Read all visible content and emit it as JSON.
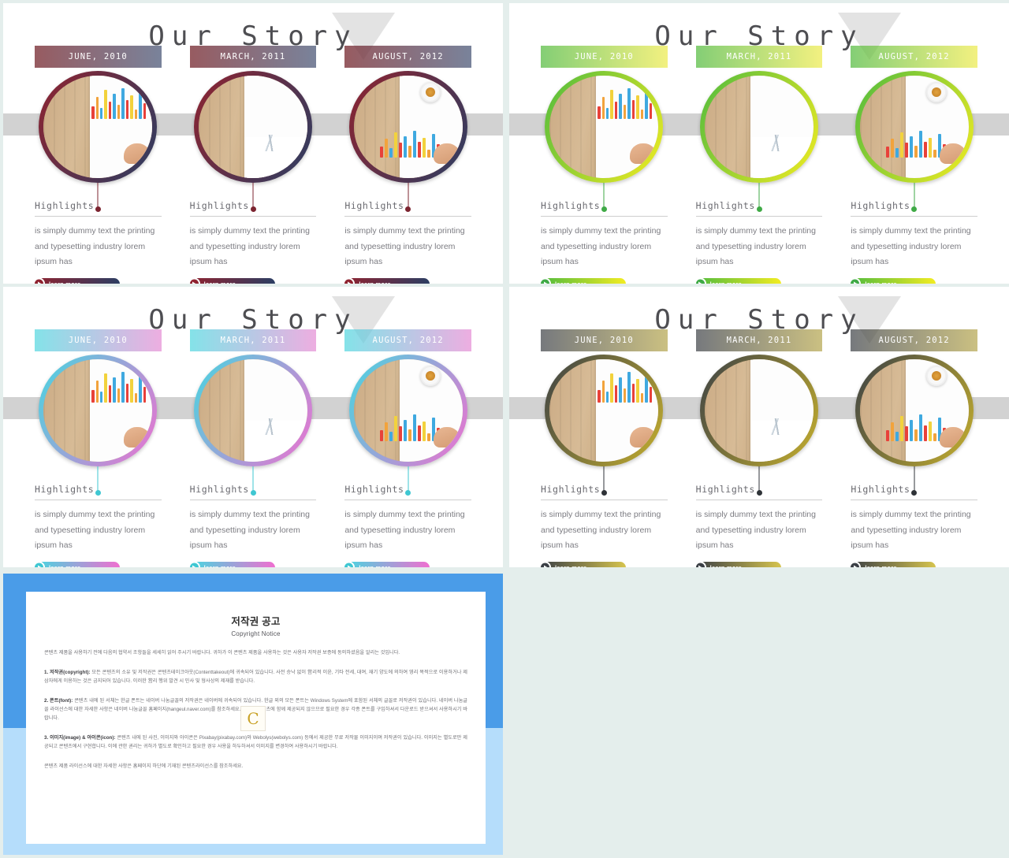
{
  "page": {
    "background_color": "#e4eeec"
  },
  "slides": [
    {
      "id": "slide-1",
      "title": "Our Story",
      "theme": {
        "name": "red-navy",
        "ring_gradient_from": "#8f2330",
        "ring_gradient_to": "#2c3e63",
        "plaque_from": "rgba(122,45,52,0.78)",
        "plaque_to": "rgba(64,78,112,0.70)",
        "connector": "#7c2430",
        "btn_from": "#8f2330",
        "btn_to": "#2c3e63",
        "icon_color": "#8f2330"
      },
      "band_color": "#d2d2d2",
      "triangle_color": "#e3e3e3",
      "columns": [
        {
          "date": "JUNE, 2010",
          "highlight_label": "Highlights",
          "body": "is simply dummy text the printing and typesetting industry lorem ipsum has",
          "button_label": "learn more",
          "photo": "wood-desk-bar-chart"
        },
        {
          "date": "MARCH, 2011",
          "highlight_label": "Highlights",
          "body": "is simply dummy text the printing and typesetting industry lorem ipsum has",
          "button_label": "learn more",
          "photo": "wood-desk-documents"
        },
        {
          "date": "AUGUST, 2012",
          "highlight_label": "Highlights",
          "body": "is simply dummy text the printing and typesetting industry lorem ipsum has",
          "button_label": "learn more",
          "photo": "wood-desk-coffee-hand"
        }
      ]
    },
    {
      "id": "slide-2",
      "title": "Our Story",
      "theme": {
        "name": "green-yellow",
        "ring_gradient_from": "#4fbb3e",
        "ring_gradient_to": "#f2ec22",
        "plaque_from": "rgba(84,187,64,0.72)",
        "plaque_to": "rgba(235,232,50,0.62)",
        "connector": "#3faa46",
        "btn_from": "#4fbb3e",
        "btn_to": "#f2ec22",
        "icon_color": "#3faa46"
      },
      "band_color": "#d2d2d2",
      "triangle_color": "#e3e3e3",
      "columns": [
        {
          "date": "JUNE, 2010",
          "highlight_label": "Highlights",
          "body": "is simply dummy text the printing and typesetting industry lorem ipsum has",
          "button_label": "learn more",
          "photo": "wood-desk-bar-chart"
        },
        {
          "date": "MARCH, 2011",
          "highlight_label": "Highlights",
          "body": "is simply dummy text the printing and typesetting industry lorem ipsum has",
          "button_label": "learn more",
          "photo": "wood-desk-documents"
        },
        {
          "date": "AUGUST, 2012",
          "highlight_label": "Highlights",
          "body": "is simply dummy text the printing and typesetting industry lorem ipsum has",
          "button_label": "learn more",
          "photo": "wood-desk-coffee-hand"
        }
      ]
    },
    {
      "id": "slide-3",
      "title": "Our Story",
      "theme": {
        "name": "cyan-pink",
        "ring_gradient_from": "#45d7e0",
        "ring_gradient_to": "#f06fd0",
        "plaque_from": "rgba(80,214,223,0.70)",
        "plaque_to": "rgba(226,124,206,0.62)",
        "connector": "#3fc7d2",
        "btn_from": "#45d7e0",
        "btn_to": "#f06fd0",
        "icon_color": "#3fc7d2"
      },
      "band_color": "#d2d2d2",
      "triangle_color": "#e3e3e3",
      "columns": [
        {
          "date": "JUNE, 2010",
          "highlight_label": "Highlights",
          "body": "is simply dummy text the printing and typesetting industry lorem ipsum has",
          "button_label": "learn more",
          "photo": "wood-desk-bar-chart"
        },
        {
          "date": "MARCH, 2011",
          "highlight_label": "Highlights",
          "body": "is simply dummy text the printing and typesetting industry lorem ipsum has",
          "button_label": "learn more",
          "photo": "wood-desk-documents"
        },
        {
          "date": "AUGUST, 2012",
          "highlight_label": "Highlights",
          "body": "is simply dummy text the printing and typesetting industry lorem ipsum has",
          "button_label": "learn more",
          "photo": "wood-desk-coffee-hand"
        }
      ]
    },
    {
      "id": "slide-4",
      "title": "Our Story",
      "theme": {
        "name": "charcoal-gold",
        "ring_gradient_from": "#3b4046",
        "ring_gradient_to": "#c6b02e",
        "plaque_from": "rgba(60,64,70,0.70)",
        "plaque_to": "rgba(168,150,46,0.60)",
        "connector": "#2f3338",
        "btn_from": "#3b4046",
        "btn_to": "#d6c44e",
        "icon_color": "#3b4046"
      },
      "band_color": "#d2d2d2",
      "triangle_color": "#e3e3e3",
      "columns": [
        {
          "date": "JUNE, 2010",
          "highlight_label": "Highlights",
          "body": "is simply dummy text the printing and typesetting industry lorem ipsum has",
          "button_label": "learn more",
          "photo": "wood-desk-bar-chart"
        },
        {
          "date": "MARCH, 2011",
          "highlight_label": "Highlights",
          "body": "is simply dummy text the printing and typesetting industry lorem ipsum has",
          "button_label": "learn more",
          "photo": "wood-desk-documents"
        },
        {
          "date": "AUGUST, 2012",
          "highlight_label": "Highlights",
          "body": "is simply dummy text the printing and typesetting industry lorem ipsum has",
          "button_label": "learn more",
          "photo": "wood-desk-coffee-hand"
        }
      ]
    }
  ],
  "copyright_slide": {
    "frame_color_top": "#4a9ce8",
    "frame_color_bottom": "#b5ddfb",
    "title": "저작권 공고",
    "subtitle": "Copyright Notice",
    "intro": "콘텐츠 제품을 사용하기 전에 다음의 협약서 조항들을 세세히 읽어 주시기 바랍니다. 귀하가 이 콘텐츠 제품을 사용하는 것은 사용자 저작권 보증에 동의하셨음을 알리는 것입니다.",
    "sections": [
      {
        "heading": "1. 저작권(copyright):",
        "text": "모든 콘텐츠의 소유 및 저작권은 콘텐츠테이크아웃(Contenttakeout)에 귀속되어 있습니다. 사전 승낙 없이 営리적 이윤, 기타 전세, 대여, 재기 양도에 의하여 영리 목적으로 이용하거나 제삼자에게 이용하는 것은 금지되어 있습니다. 이러한 営리 행위 발견 시 민사 및 형사상의 제재를 받습니다."
      },
      {
        "heading": "2. 폰트(font):",
        "text": "콘텐츠 내에 된 서체는 한글 폰트는 네이버 나눔글꼴의 저작권은 네이버에 귀속되어 있습니다. 한글 외의 모든 폰트는 Windows System에 포함된 서체의 글꼴로 저작권이 있습니다. 네이버 나눔글꼴 라이선스에 대한 자세한 사항은 네이버 나눔글꼴 홈페이지(hangeul.naver.com)를 참조하세요. 폰트는 콘텐츠에 함께 제공되지 않으므로 필요한 경우 각종 폰트를 구입하셔서 다운로드 받으셔서 사용하시기 바랍니다."
      },
      {
        "heading": "3. 이미지(image) & 아이콘(icon):",
        "text": "콘텐츠 내에 된 사진, 이미지와 아이콘은 Pixabay(pixabay.com)와 Webolys(webolys.com) 등에서 제공한 무료 저작물 이미지이며 저작권이 있습니다. 이미지는 별도로만 제공되고 콘텐츠에서 구현합니다. 이에 관한 권리는 귀하가 별도로 확인하고 필요한 경우 사용을 하두하셔서 이미지를 변경하여 사용하시기 바랍니다."
      }
    ],
    "footer": "콘텐츠 제품 라이선스에 대한 자세한 사항은 홈페이지 하단에 기재된 콘텐츠라이선스를 참조하세요.",
    "watermark": "C"
  }
}
